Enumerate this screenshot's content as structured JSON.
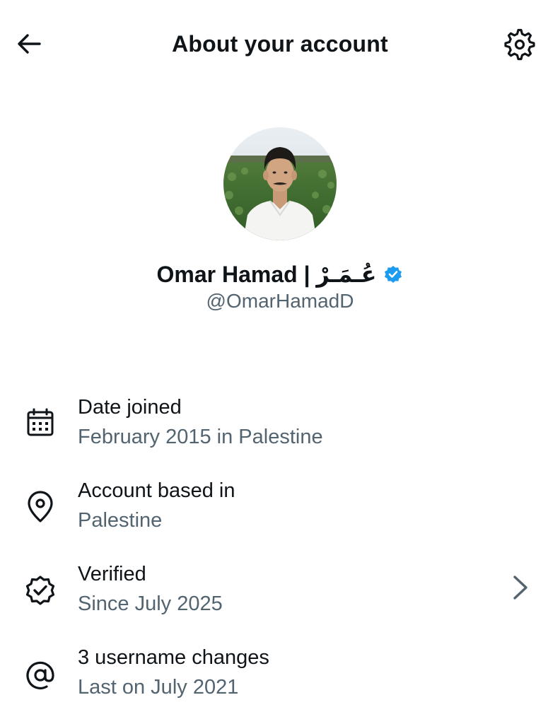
{
  "header": {
    "title": "About your account",
    "back_icon": "arrow-left-icon",
    "settings_icon": "gear-icon"
  },
  "profile": {
    "display_name": "Omar Hamad | عُـمَـرْ",
    "handle": "@OmarHamadD",
    "verified_color": "#1d9bf0"
  },
  "info_items": [
    {
      "icon": "calendar-icon",
      "title": "Date joined",
      "subtitle": "February 2015 in Palestine"
    },
    {
      "icon": "location-pin-icon",
      "title": "Account based in",
      "subtitle": "Palestine"
    },
    {
      "icon": "verified-check-icon",
      "title": "Verified",
      "subtitle": "Since July 2025"
    },
    {
      "icon": "at-sign-icon",
      "title": "3 username changes",
      "subtitle": "Last on July 2021"
    }
  ],
  "colors": {
    "text_primary": "#0f1419",
    "text_secondary": "#536471",
    "accent": "#1d9bf0"
  }
}
